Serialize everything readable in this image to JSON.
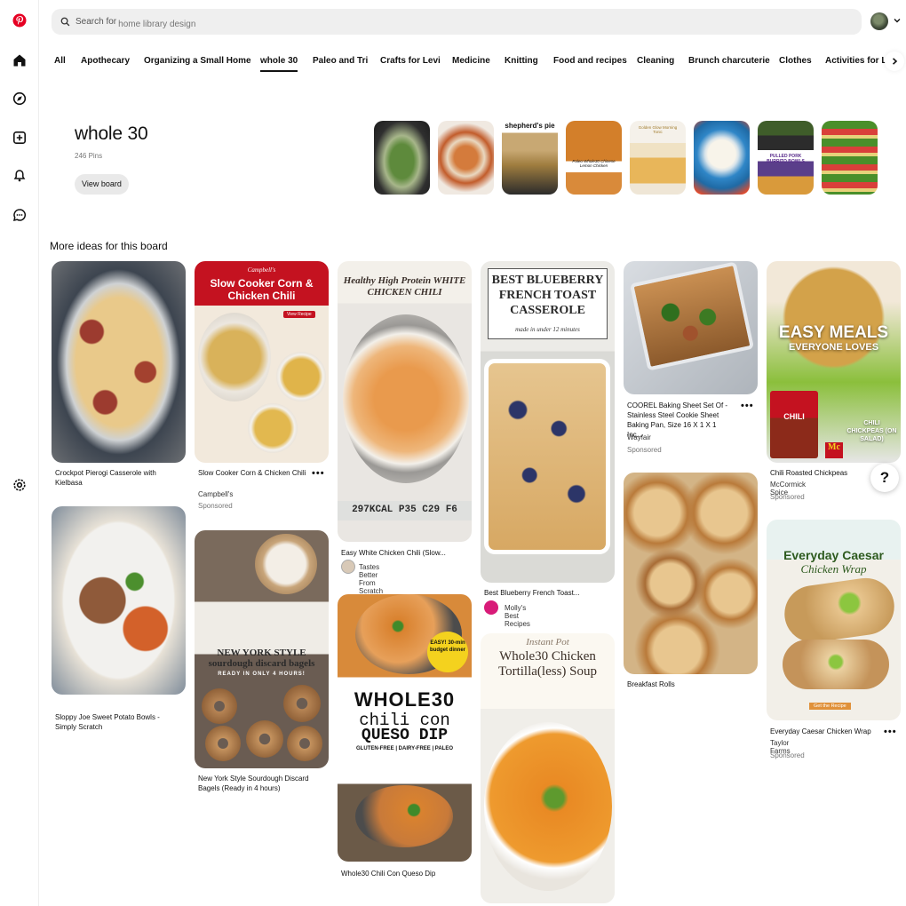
{
  "search": {
    "placeholder": "Search for",
    "query": "home library design"
  },
  "tabs": [
    "All",
    "Apothecary",
    "Organizing a Small Home",
    "whole 30",
    "Paleo and Tri",
    "Crafts for Levi",
    "Medicine",
    "Knitting",
    "Food and recipes",
    "Cleaning",
    "Brunch charcuterie",
    "Clothes",
    "Activities for Le"
  ],
  "board": {
    "title": "whole 30",
    "count": "246 Pins",
    "view_button": "View board"
  },
  "thumbs": [
    {
      "label": ""
    },
    {
      "label": ""
    },
    {
      "label": "shepherd's pie"
    },
    {
      "label": "Paleo Whole30 Chinese Lemon Chicken"
    },
    {
      "label": "Golden Glow Morning Tonic"
    },
    {
      "label": ""
    },
    {
      "label": "PULLED PORK BURRITO BOWLS"
    },
    {
      "label": ""
    }
  ],
  "section_title": "More ideas for this board",
  "pins": {
    "pierogi": {
      "title": "Crockpot Pierogi Casserole with Kielbasa"
    },
    "corn_chili": {
      "title": "Slow Cooker Corn & Chicken Chili",
      "source": "Campbell's",
      "sponsored": "Sponsored",
      "overlay_brand": "Campbell's",
      "overlay": "Slow Cooker Corn & Chicken Chili",
      "cta": "View Recipe"
    },
    "white_chili": {
      "title": "Easy White Chicken Chili (Slow...",
      "source": "Tastes Better From Scratch |...",
      "overlay": "Healthy High Protein WHITE CHICKEN CHILI",
      "macros": "297KCAL  P35  C29  F6"
    },
    "blueberry": {
      "title": "Best Blueberry French Toast...",
      "source": "Molly's Best Recipes",
      "overlay": "BEST BLUEBERRY FRENCH TOAST CASSEROLE",
      "overlay_sub": "made in under 12 minutes"
    },
    "baking_sheet": {
      "title": "COOREL Baking Sheet Set Of - Stainless Steel Cookie Sheet Baking Pan, Size 16 X 1 X 1 Inc...",
      "source": "Wayfair",
      "sponsored": "Sponsored"
    },
    "chickpeas": {
      "title": "Chili Roasted Chickpeas",
      "source": "McCormick Spice",
      "sponsored": "Sponsored",
      "overlay": "EASY MEALS",
      "overlay_sub": "EVERYONE LOVES",
      "overlay_small": "CHILI CHICKPEAS (ON SALAD)",
      "package": "CHILI"
    },
    "sloppy_joe": {
      "title": "Sloppy Joe Sweet Potato Bowls - Simply Scratch"
    },
    "bagels": {
      "title": "New York Style Sourdough Discard Bagels (Ready in 4 hours)",
      "overlay": "NEW YORK STYLE sourdough discard bagels",
      "overlay_sub": "READY IN ONLY 4 HOURS!"
    },
    "queso": {
      "title": "Whole30 Chili Con Queso Dip",
      "overlay": "WHOLE30",
      "overlay2": "chili con",
      "overlay3": "QUESO DIP",
      "overlay_sub": "GLUTEN-FREE | DAIRY-FREE | PALEO",
      "badge": "EASY! 30-min budget dinner"
    },
    "soup": {
      "overlay_script": "Instant Pot",
      "overlay": "Whole30 Chicken Tortilla(less) Soup"
    },
    "rolls": {
      "title": "Breakfast Rolls"
    },
    "caesar": {
      "title": "Everyday Caesar Chicken Wrap",
      "source": "Taylor Farms",
      "sponsored": "Sponsored",
      "overlay": "Everyday Caesar",
      "overlay_sub": "Chicken Wrap",
      "cta": "Get the Recipe"
    }
  },
  "colors": {
    "brand": "#e60023",
    "search_bg": "#efefef",
    "muted_text": "#767676"
  }
}
